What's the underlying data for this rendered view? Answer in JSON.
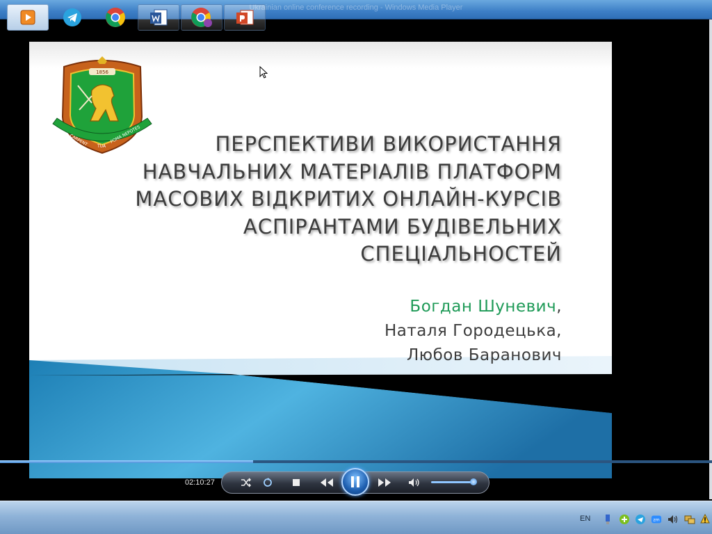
{
  "window": {
    "title": "Ukrainian online conference recording - Windows Media Player"
  },
  "slide": {
    "title_lines": [
      "ПЕРСПЕКТИВИ ВИКОРИСТАННЯ",
      "НАВЧАЛЬНИХ МАТЕРІАЛІВ ПЛАТФОРМ",
      "МАСОВИХ ВІДКРИТИХ ОНЛАЙН-КУРСІВ",
      "АСПІРАНТАМИ БУДІВЕЛЬНИХ",
      "СПЕЦІАЛЬНОСТЕЙ"
    ],
    "crest_year": "1856",
    "crest_motto_left": "CARPENT",
    "crest_motto_mid": "TUA",
    "crest_motto_right": "POMA NEPOTES",
    "author_main": "Богдан Шуневич",
    "author_main_suffix": ",",
    "author_2": "Наталя Городецька,",
    "author_3": "Любов Баранович",
    "colors": {
      "title": "#3b3b3b",
      "author_highlight": "#1e9a57",
      "wave": "#2a8fc4"
    }
  },
  "player": {
    "time": "02:10:27",
    "progress": 0.355,
    "volume": 0.9
  },
  "taskbar": {
    "language": "EN",
    "apps": [
      {
        "name": "media-player-app",
        "icon": "media-player-icon"
      },
      {
        "name": "telegram-app",
        "icon": "telegram-icon"
      },
      {
        "name": "chrome-app",
        "icon": "chrome-icon"
      },
      {
        "name": "word-app",
        "icon": "word-icon"
      },
      {
        "name": "chrome-profile-app",
        "icon": "chrome-profile-icon"
      },
      {
        "name": "powerpoint-app",
        "icon": "powerpoint-icon"
      }
    ],
    "tray": [
      "usb-icon",
      "green-plus-icon",
      "telegram-tray-icon",
      "zoom-icon",
      "volume-tray-icon",
      "network-icon",
      "notification-icon"
    ]
  }
}
